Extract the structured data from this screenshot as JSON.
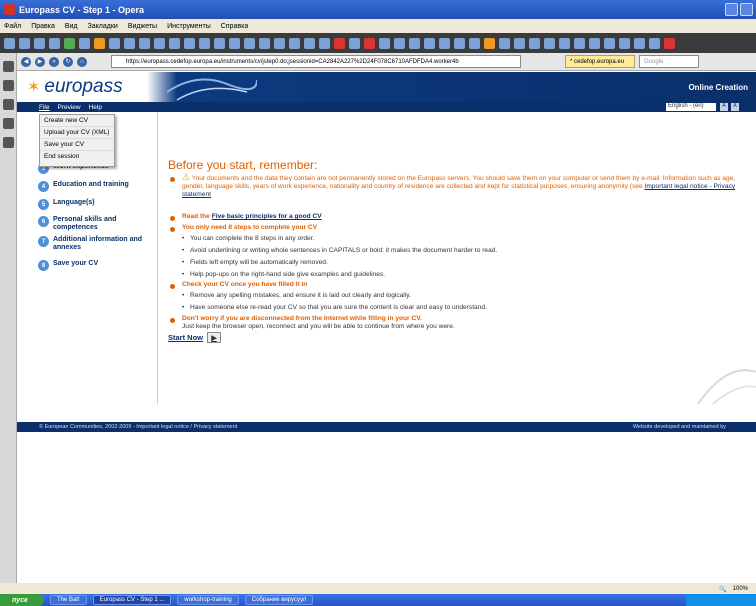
{
  "window": {
    "title": "Europass CV - Step 1 - Opera"
  },
  "menu": [
    "Файл",
    "Правка",
    "Вид",
    "Закладки",
    "Виджеты",
    "Инструменты",
    "Справка"
  ],
  "address": {
    "url": "https://europass.cedefop.europa.eu/instruments/cv/jstep0.do;jsessionid=CA2842A227%2D24F078C6710AFDFDA4.worker4b",
    "site": "* cedefop.europa.eu",
    "search": "Google"
  },
  "header": {
    "logo": "europass",
    "online_creation": "Online Creation"
  },
  "nav": {
    "file": "File",
    "preview": "Preview",
    "help": "Help",
    "language": "English - (en)",
    "btn_a1": "A",
    "btn_a2": "A"
  },
  "file_menu": [
    "Create new CV",
    "Upload your CV (XML)",
    "Save your CV",
    "End session"
  ],
  "steps": [
    {
      "num": "3",
      "label": "Work experience"
    },
    {
      "num": "4",
      "label": "Education and training"
    },
    {
      "num": "5",
      "label": "Language(s)"
    },
    {
      "num": "6",
      "label": "Personal skills and competences"
    },
    {
      "num": "7",
      "label": "Additional information and annexes"
    },
    {
      "num": "8",
      "label": "Save your CV"
    }
  ],
  "main": {
    "heading": "Before you start, remember:",
    "warning": "Your documents and the data they contain are not permanently stored on the Europass servers. You should save them on your computer or send them by e-mail. Information such as age, gender, language skills, years of work experience, nationality and country of residence are collected and kept for statistical purposes, ensuring anonymity (see",
    "warning_link": "Important legal notice - Privacy statement",
    "read_pre": "Read the",
    "read_link": "Five basic principles for a good CV",
    "need8": "You only need 8 steps to complete your CV",
    "need8_items": [
      "You can complete the 8 steps in any order.",
      "Avoid underlining or writing whole sentences in CAPITALS or bold: it makes the document harder to read.",
      "Fields left empty will be automatically removed.",
      "Help pop-ups on the right-hand side give examples and guidelines."
    ],
    "check": "Check your CV once you have filled it in",
    "check_items": [
      "Remove any spelling mistakes, and ensure it is laid out clearly and logically.",
      "Have someone else re-read your CV so that you are sure the content is clear and easy to understand."
    ],
    "dontworry": "Don't worry if you are disconnected from the Internet while filling in your CV.",
    "dontworry_2": "Just keep the browser open, reconnect and you will be able to continue from where you were.",
    "start_now": "Start Now"
  },
  "footer": {
    "left": "© European Communities, 2002-2009 - Important legal notice / Privacy statement",
    "right": "Website developed and maintained by"
  },
  "status": {
    "zoom": "100%"
  },
  "taskbar": {
    "start": "пуск",
    "tasks": [
      "The Bat!",
      "Europass CV - Step 1 ...",
      "workshop-training",
      "Собрание вирусуул"
    ]
  }
}
